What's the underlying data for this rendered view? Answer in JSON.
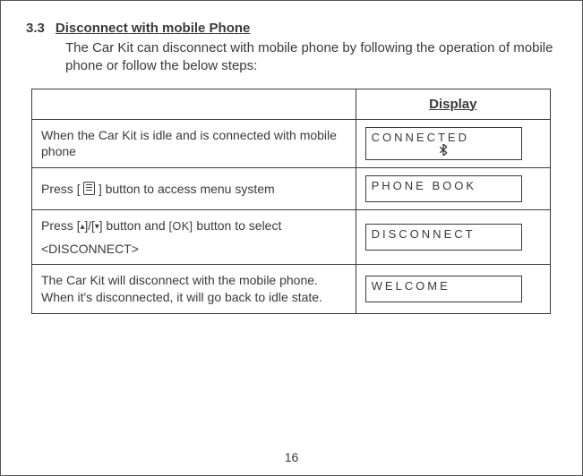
{
  "section": {
    "number": "3.3",
    "title": "Disconnect with mobile Phone",
    "intro": "The Car Kit can disconnect with mobile phone by following the operation of mobile phone or follow the below steps:"
  },
  "table": {
    "display_header": "Display",
    "rows": [
      {
        "instruction": "When the Car Kit is idle and is connected with mobile phone",
        "display": "CONNECTED",
        "bluetooth": true
      },
      {
        "instruction_parts": {
          "pre": "Press ",
          "key_open": "[ ",
          "key_close": " ]",
          "post": " button to access menu system"
        },
        "display": "PHONE  BOOK"
      },
      {
        "instruction_parts": {
          "pre": "Press ",
          "updown": "[▴]/[▾]",
          "mid": " button and ",
          "ok": "[OK]",
          "post": " button to select",
          "line2": "<DISCONNECT>"
        },
        "display": "DISCONNECT"
      },
      {
        "instruction": "The Car Kit will disconnect with the mobile phone. When it's disconnected, it will go back to idle state.",
        "display": "WELCOME"
      }
    ]
  },
  "page_number": "16"
}
